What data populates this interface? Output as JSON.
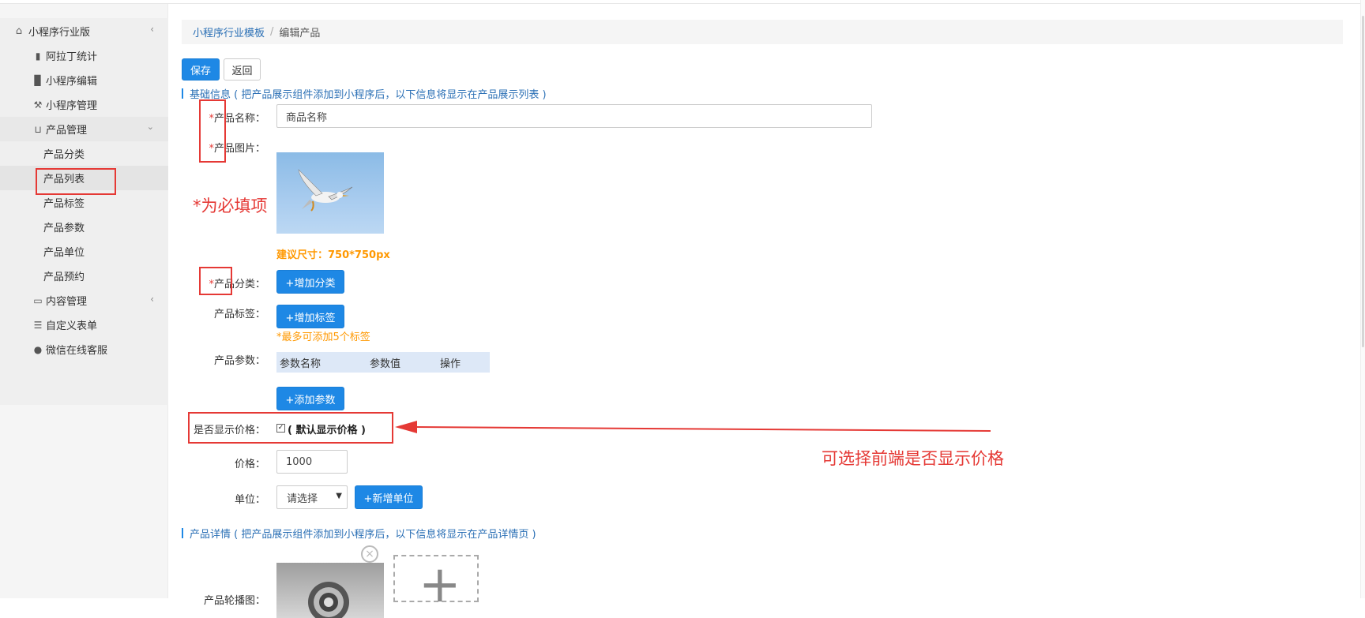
{
  "sidebar": {
    "app_title": "小程序行业版",
    "items": [
      {
        "label": "阿拉丁统计",
        "icon": "bar-chart-icon"
      },
      {
        "label": "小程序编辑",
        "icon": "book-icon"
      },
      {
        "label": "小程序管理",
        "icon": "wrench-icon"
      }
    ],
    "product_group": {
      "label": "产品管理",
      "icon": "cart-icon",
      "children": [
        "产品分类",
        "产品列表",
        "产品标签",
        "产品参数",
        "产品单位",
        "产品预约"
      ]
    },
    "content_group": {
      "label": "内容管理",
      "icon": "folder-icon"
    },
    "custom_form": {
      "label": "自定义表单",
      "icon": "list-icon"
    },
    "wechat_service": {
      "label": "微信在线客服",
      "icon": "user-icon"
    }
  },
  "breadcrumb": {
    "parent": "小程序行业模板",
    "separator": "/",
    "current": "编辑产品"
  },
  "toolbar": {
    "save_label": "保存",
    "back_label": "返回"
  },
  "basic_section": {
    "title": "基础信息 ( 把产品展示组件添加到小程序后，以下信息将显示在产品展示列表 )"
  },
  "form": {
    "required_mark": "*",
    "name_label": "产品名称：",
    "name_value": "商品名称",
    "image_label": "产品图片：",
    "image_hint": "建议尺寸：750*750px",
    "category_label": "产品分类：",
    "add_category_button": "+增加分类",
    "tag_label": "产品标签：",
    "add_tag_button": "+增加标签",
    "tag_hint": "*最多可添加5个标签",
    "param_label": "产品参数：",
    "param_columns": [
      "参数名称",
      "参数值",
      "操作"
    ],
    "add_param_button": "+添加参数",
    "show_price_label": "是否显示价格：",
    "show_price_checked": true,
    "show_price_text": "( 默认显示价格 )",
    "price_label": "价格：",
    "price_value": "1000",
    "unit_label": "单位：",
    "unit_select_value": "请选择",
    "add_unit_button": "+新增单位",
    "carousel_label": "产品轮播图："
  },
  "detail_section": {
    "title": "产品详情 ( 把产品展示组件添加到小程序后，以下信息将显示在产品详情页 )"
  },
  "annotations": {
    "required_note": "*为必填项",
    "price_note": "可选择前端是否显示价格",
    "color": "#e53935"
  },
  "colors": {
    "primary": "#1e88e5",
    "link": "#2a6fb5",
    "warning": "#ff9800"
  }
}
